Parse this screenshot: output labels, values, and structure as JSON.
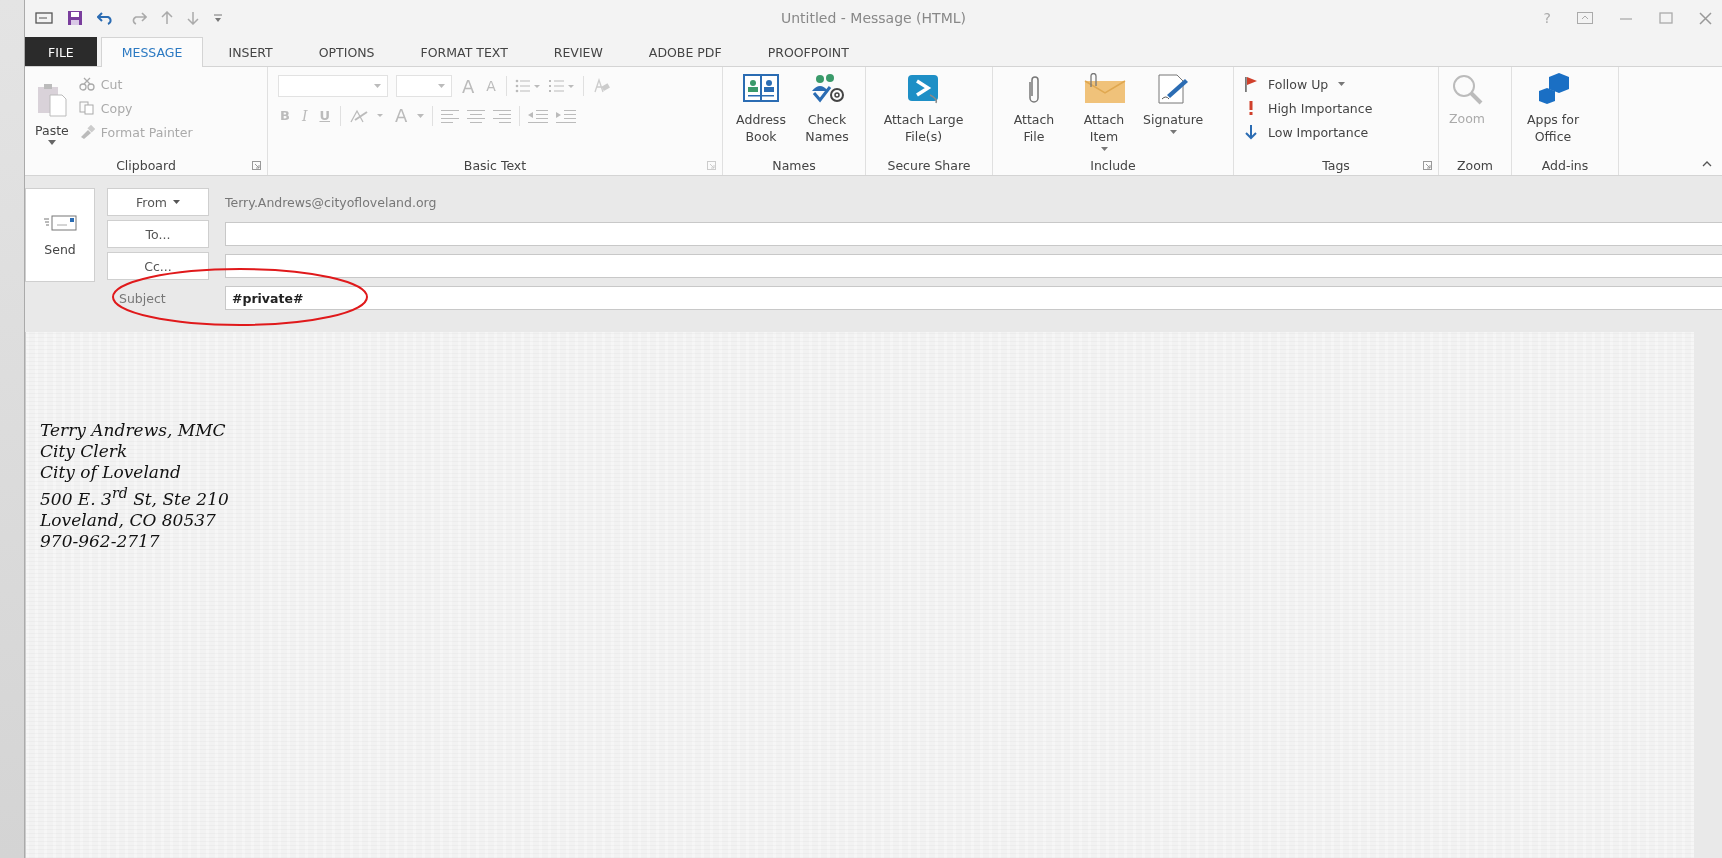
{
  "title_bar": {
    "title": "Untitled - Message (HTML)",
    "help": "?"
  },
  "tabs": [
    {
      "label": "FILE",
      "kind": "backstage",
      "selected": false
    },
    {
      "label": "MESSAGE",
      "kind": "tab",
      "selected": true
    },
    {
      "label": "INSERT",
      "kind": "tab",
      "selected": false
    },
    {
      "label": "OPTIONS",
      "kind": "tab",
      "selected": false
    },
    {
      "label": "FORMAT TEXT",
      "kind": "tab",
      "selected": false
    },
    {
      "label": "REVIEW",
      "kind": "tab",
      "selected": false
    },
    {
      "label": "ADOBE PDF",
      "kind": "tab",
      "selected": false
    },
    {
      "label": "PROOFPOINT",
      "kind": "tab",
      "selected": false
    }
  ],
  "ribbon": {
    "clipboard": {
      "label": "Clipboard",
      "paste": "Paste",
      "items": [
        {
          "label": "Cut",
          "disabled": true
        },
        {
          "label": "Copy",
          "disabled": true
        },
        {
          "label": "Format Painter",
          "disabled": true
        }
      ]
    },
    "basic_text": {
      "label": "Basic Text",
      "disabled": true,
      "grow_font": "A",
      "shrink_font": "A",
      "bold": "B",
      "italic": "I",
      "underline": "U",
      "font_color": "A"
    },
    "names": {
      "label": "Names",
      "buttons": [
        "Address Book",
        "Check Names"
      ]
    },
    "secure_share": {
      "label": "Secure Share",
      "button": "Attach Large File(s)"
    },
    "include": {
      "label": "Include",
      "buttons": [
        {
          "label": "Attach File",
          "menu": false
        },
        {
          "label": "Attach Item",
          "menu": true
        },
        {
          "label": "Signature",
          "menu": true
        }
      ]
    },
    "tags": {
      "label": "Tags",
      "items": [
        {
          "label": "Follow Up",
          "menu": true
        },
        {
          "label": "High Importance",
          "menu": false
        },
        {
          "label": "Low Importance",
          "menu": false
        }
      ]
    },
    "zoom": {
      "label": "Zoom",
      "button": "Zoom",
      "disabled": true
    },
    "add_ins": {
      "label": "Add-ins",
      "button": "Apps for Office"
    }
  },
  "header": {
    "send": "Send",
    "from_button": "From",
    "from_value": "Terry.Andrews@cityofloveland.org",
    "to_button": "To...",
    "cc_button": "Cc...",
    "subject_label": "Subject",
    "subject_value": "#private#"
  },
  "body": {
    "signature": [
      "Terry Andrews, MMC",
      "City Clerk",
      "City of Loveland",
      "500 E. 3$^{rd}$ St, Ste 210",
      "Loveland, CO 80537",
      "970-962-2717"
    ]
  }
}
